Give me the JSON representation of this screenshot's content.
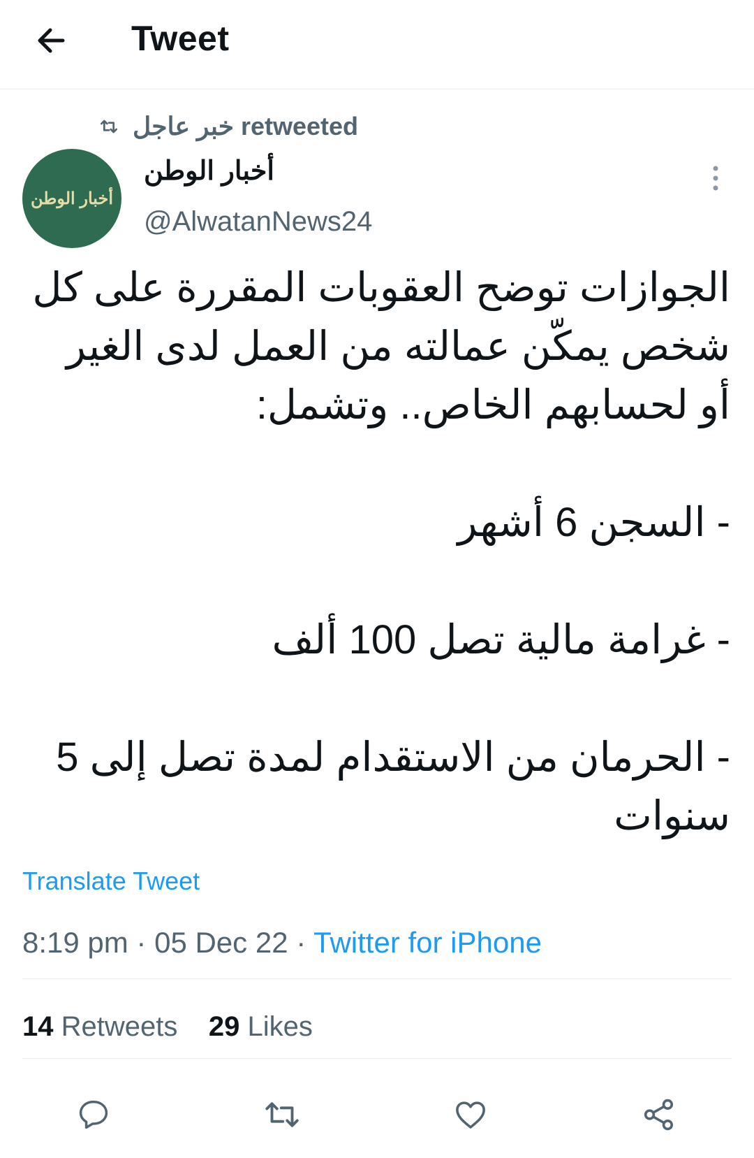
{
  "header": {
    "title": "Tweet",
    "back_icon": "arrow-left-icon"
  },
  "retweet_line": {
    "icon": "retweet-icon",
    "label": "خبر عاجل retweeted"
  },
  "author": {
    "avatar_text": "أخبار الوطن",
    "avatar_color": "#2e6b51",
    "name": "أخبار الوطن",
    "handle": "@AlwatanNews24"
  },
  "tweet": {
    "text": "الجوازات توضح العقوبات المقررة على كل شخص يمكّن عمالته من العمل لدى الغير أو لحسابهم الخاص.. وتشمل:\n\n- السجن 6 أشهر\n\n- غرامة مالية تصل 100 ألف\n\n- الحرمان من الاستقدام لمدة تصل إلى 5 سنوات",
    "translate_label": "Translate Tweet",
    "time": "8:19 pm",
    "separator": " · ",
    "date": "05 Dec 22",
    "client": "Twitter for iPhone"
  },
  "stats": {
    "retweets_count": "14",
    "retweets_label": "Retweets",
    "likes_count": "29",
    "likes_label": "Likes"
  },
  "actions": [
    {
      "icon": "reply-icon"
    },
    {
      "icon": "retweet-icon"
    },
    {
      "icon": "like-icon"
    },
    {
      "icon": "share-icon"
    }
  ],
  "colors": {
    "link": "#1d9bf0",
    "muted": "#536471",
    "text": "#0f1419",
    "divider": "#e6ecf0"
  }
}
